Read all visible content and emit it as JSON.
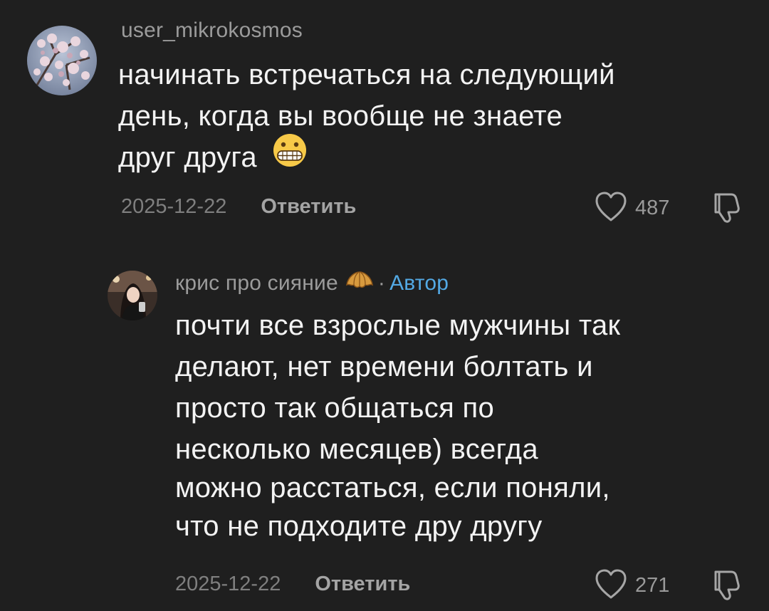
{
  "comments": [
    {
      "username": "user_mikrokosmos",
      "text_lines": [
        "начинать встречаться на следующий",
        "день, когда вы вообще не знаете",
        "друг друга"
      ],
      "text_emoji": "grimacing-face-emoji",
      "date": "2025-12-22",
      "reply_label": "Ответить",
      "likes": "487"
    },
    {
      "username": "крис про сияние",
      "username_emoji": "croissant-emoji",
      "separator": "·",
      "author_label": "Автор",
      "text_lines": [
        "почти все взрослые мужчины так",
        "делают, нет времени болтать и",
        "просто так общаться по",
        "несколько месяцев) всегда",
        "можно расстаться, если поняли,",
        "что не подходите дру другу"
      ],
      "date": "2025-12-22",
      "reply_label": "Ответить",
      "likes": "271"
    }
  ],
  "colors": {
    "background": "#1f1f1f",
    "text": "#f3f3f3",
    "muted": "#9b9b9b",
    "author_accent": "#53a9e4"
  },
  "icons": {
    "like": "heart-outline-icon",
    "dislike": "thumbs-down-icon"
  }
}
